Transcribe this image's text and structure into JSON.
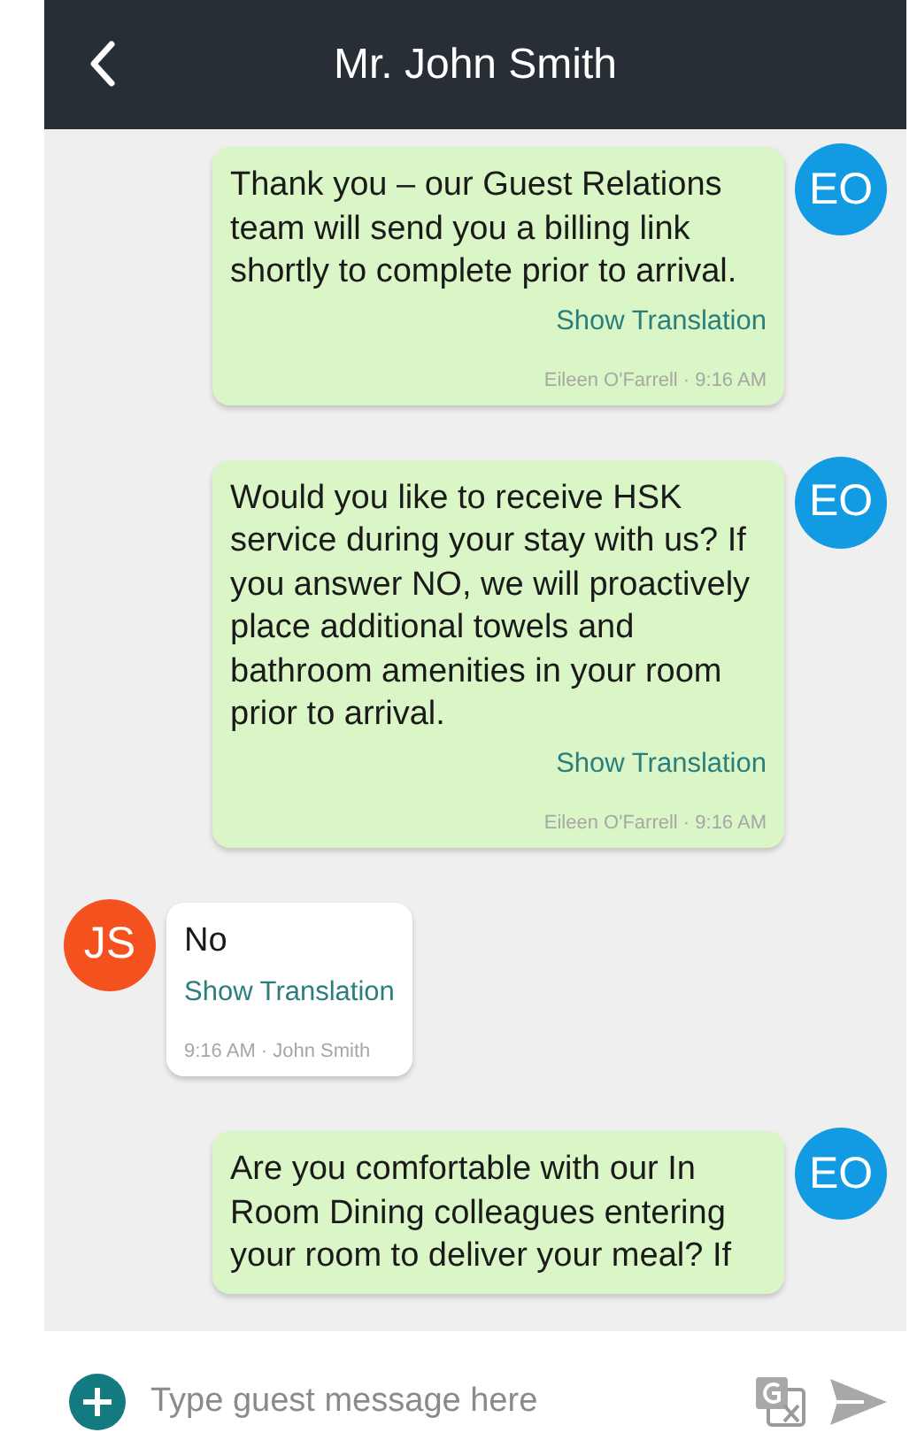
{
  "header": {
    "title": "Mr. John Smith"
  },
  "messages": [
    {
      "kind": "outgoing",
      "initials": "EO",
      "color": "#129be3",
      "text": "Thank you – our Guest Relations team will send you a billing link shortly to complete prior to arrival.",
      "action": "Show Translation",
      "meta": "Eileen O'Farrell · 9:16 AM"
    },
    {
      "kind": "outgoing",
      "initials": "EO",
      "color": "#129be3",
      "text": "Would you like to receive HSK service during your stay with us? If you answer NO, we will proactively place additional towels and bathroom amenities in your room prior to arrival.",
      "action": "Show Translation",
      "meta": "Eileen O'Farrell · 9:16 AM"
    },
    {
      "kind": "incoming",
      "initials": "JS",
      "color": "#f4511e",
      "text": "No",
      "action": "Show Translation",
      "meta": "9:16 AM · John Smith"
    },
    {
      "kind": "outgoing",
      "initials": "EO",
      "color": "#129be3",
      "text": "Are you comfortable with our In Room Dining colleagues entering your room to deliver your meal? If"
    }
  ],
  "composer": {
    "placeholder": "Type guest message here"
  }
}
